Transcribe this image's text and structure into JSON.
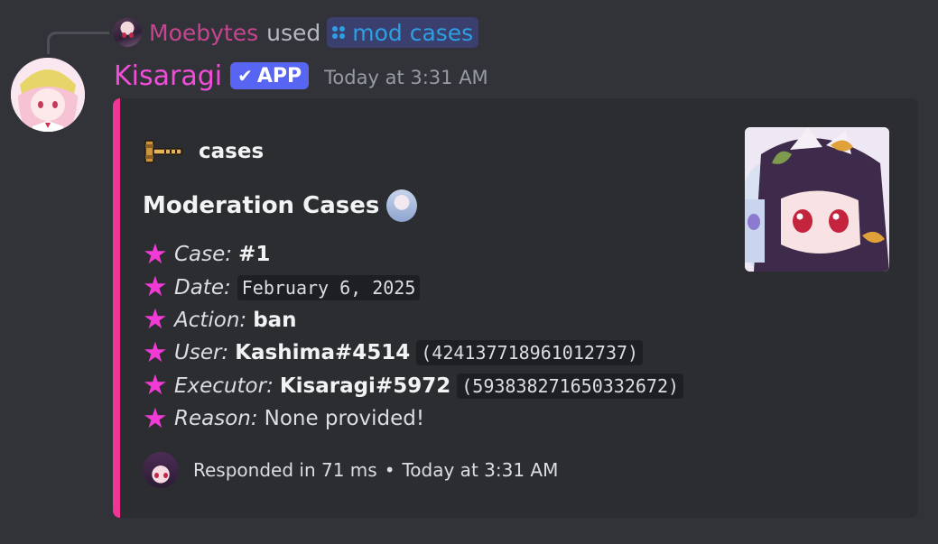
{
  "reply": {
    "user_name": "Moebytes",
    "used_text": "used",
    "command": "mod cases"
  },
  "message": {
    "bot_name": "Kisaragi",
    "badge": "APP",
    "timestamp": "Today at 3:31 AM"
  },
  "embed": {
    "accent_color": "#f13596",
    "author": "cases",
    "title": "Moderation Cases",
    "fields": [
      {
        "label": "Case:",
        "value": "#1"
      },
      {
        "label": "Date:",
        "code": "February 6, 2025"
      },
      {
        "label": "Action:",
        "value": "ban"
      },
      {
        "label": "User:",
        "value": "Kashima#4514",
        "code": "(424137718961012737)"
      },
      {
        "label": "Executor:",
        "value": "Kisaragi#5972",
        "code": "(593838271650332672)"
      },
      {
        "label": "Reason:",
        "plain": "None provided!"
      }
    ],
    "footer": {
      "text": "Responded in 71 ms",
      "separator": "•",
      "time": "Today at 3:31 AM"
    }
  },
  "icons": {
    "star": "★",
    "check": "✔"
  },
  "colors": {
    "background": "#323339",
    "embed_background": "#2b2d31",
    "bot_name": "#f04ed8",
    "reply_name": "#c64590",
    "star": "#f23ad6",
    "app_badge": "#5865f2",
    "command_link": "#2e9fe3"
  }
}
